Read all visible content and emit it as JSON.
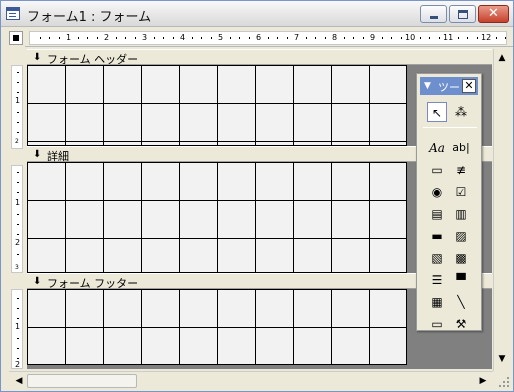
{
  "window": {
    "title": "フォーム1 : フォーム",
    "close_label": "✕"
  },
  "ruler": {
    "numbers": [
      "1",
      "2",
      "3",
      "4",
      "5",
      "6",
      "7",
      "8",
      "9",
      "10",
      "11",
      "12"
    ]
  },
  "vertical_ruler": {
    "header_numbers": [
      "1",
      "2"
    ],
    "detail_numbers": [
      "1",
      "2",
      "3"
    ],
    "footer_numbers": [
      "1",
      "2"
    ]
  },
  "sections": {
    "header": {
      "label": "フォーム ヘッダー"
    },
    "detail": {
      "label": "詳細"
    },
    "footer": {
      "label": "フォーム フッター"
    }
  },
  "toolbox": {
    "title": "ツー",
    "close_label": "✕",
    "tools": [
      {
        "name": "select-objects-icon",
        "glyph": "↖"
      },
      {
        "name": "control-wizards-icon",
        "glyph": "⁂"
      },
      {
        "name": "label-icon",
        "glyph": "Aa"
      },
      {
        "name": "textbox-icon",
        "glyph": "ab|"
      },
      {
        "name": "option-group-icon",
        "glyph": "▭"
      },
      {
        "name": "toggle-button-icon",
        "glyph": "≢"
      },
      {
        "name": "option-button-icon",
        "glyph": "◉"
      },
      {
        "name": "checkbox-icon",
        "glyph": "☑"
      },
      {
        "name": "combo-box-icon",
        "glyph": "▤"
      },
      {
        "name": "list-box-icon",
        "glyph": "▥"
      },
      {
        "name": "command-button-icon",
        "glyph": "▬"
      },
      {
        "name": "image-icon",
        "glyph": "▨"
      },
      {
        "name": "unbound-object-frame-icon",
        "glyph": "▧"
      },
      {
        "name": "bound-object-frame-icon",
        "glyph": "▩"
      },
      {
        "name": "page-break-icon",
        "glyph": "☰"
      },
      {
        "name": "tab-control-icon",
        "glyph": "▀"
      },
      {
        "name": "subform-icon",
        "glyph": "▦"
      },
      {
        "name": "line-icon",
        "glyph": "╲"
      },
      {
        "name": "rectangle-icon",
        "glyph": "▭"
      },
      {
        "name": "more-controls-icon",
        "glyph": "⚒"
      }
    ]
  },
  "colors": {
    "title_bar": "#d9d9d9",
    "toolbox_title": "#6e8fce",
    "design_background": "#808080",
    "grid_background": "#f2f2f2"
  }
}
